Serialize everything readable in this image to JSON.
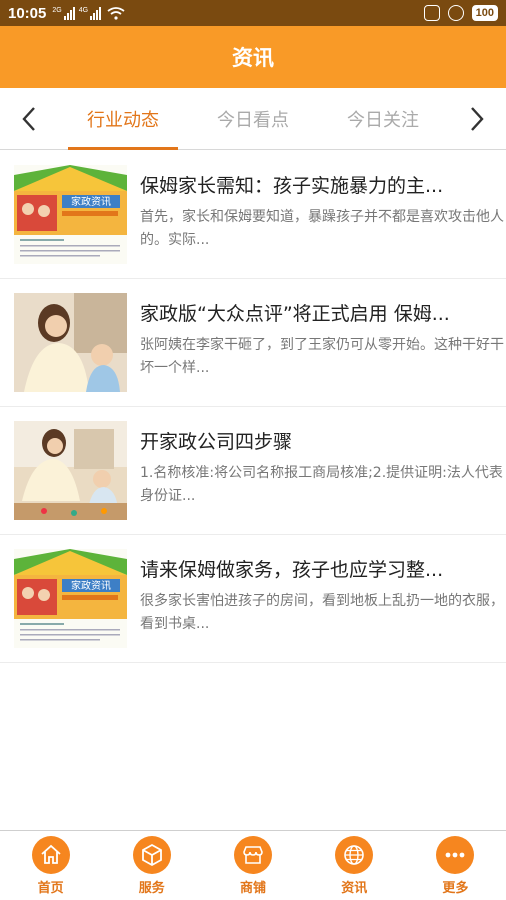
{
  "status": {
    "time": "10:05",
    "sig1_tag": "2G",
    "sig2_tag": "4G",
    "battery": "100"
  },
  "header": {
    "title": "资讯"
  },
  "tabs": {
    "prev_icon": "chevron-left-icon",
    "next_icon": "chevron-right-icon",
    "items": [
      {
        "label": "行业动态",
        "active": true
      },
      {
        "label": "今日看点",
        "active": false
      },
      {
        "label": "今日关注",
        "active": false
      }
    ]
  },
  "articles": [
    {
      "title": "保姆家长需知：孩子实施暴力的主...",
      "desc": "首先，家长和保姆要知道，暴躁孩子并不都是喜欢攻击他人的。实际...",
      "thumb_text": "家政资讯"
    },
    {
      "title": "家政版“大众点评”将正式启用 保姆...",
      "desc": "张阿姨在李家干砸了，到了王家仍可从零开始。这种干好干坏一个样..."
    },
    {
      "title": "开家政公司四步骤",
      "desc": "1.名称核准:将公司名称报工商局核准;2.提供证明:法人代表身份证..."
    },
    {
      "title": "请来保姆做家务，孩子也应学习整...",
      "desc": "很多家长害怕进孩子的房间，看到地板上乱扔一地的衣服，看到书桌...",
      "thumb_text": "家政资讯"
    }
  ],
  "bottom_nav": [
    {
      "label": "首页",
      "icon": "home-icon"
    },
    {
      "label": "服务",
      "icon": "box-icon"
    },
    {
      "label": "商铺",
      "icon": "store-icon"
    },
    {
      "label": "资讯",
      "icon": "globe-icon"
    },
    {
      "label": "更多",
      "icon": "more-icon"
    }
  ],
  "colors": {
    "accent": "#f99a27",
    "accent_dark": "#e2761a",
    "status_bg": "#7a4a10"
  }
}
